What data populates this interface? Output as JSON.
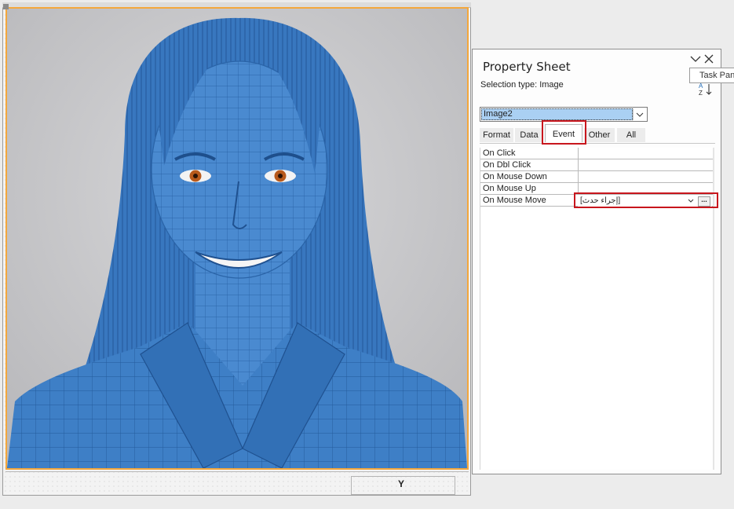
{
  "property_sheet": {
    "title": "Property Sheet",
    "tooltip": "Task Pan",
    "selection_type_label": "Selection type:  Image",
    "object_selector_value": "Image2",
    "tabs": [
      {
        "label": "Format"
      },
      {
        "label": "Data"
      },
      {
        "label": "Event"
      },
      {
        "label": "Other"
      },
      {
        "label": "All"
      }
    ],
    "active_tab": "Event",
    "properties": [
      {
        "name": "On Click",
        "value": ""
      },
      {
        "name": "On Dbl Click",
        "value": ""
      },
      {
        "name": "On Mouse Down",
        "value": ""
      },
      {
        "name": "On Mouse Up",
        "value": ""
      },
      {
        "name": "On Mouse Move",
        "value": "[إجراء حدث]"
      }
    ],
    "build_button": "..."
  },
  "design_surface": {
    "footer_label": "Y"
  },
  "colors": {
    "selection_border": "#f4a73c",
    "highlight": "#c8161d",
    "selector_fill": "#aad0f3",
    "wireframe_blue": "#3f7fc4"
  },
  "icons": [
    "chevron-down-icon",
    "close-icon",
    "sort-az-icon",
    "dropdown-arrow-icon",
    "build-ellipsis-icon"
  ]
}
